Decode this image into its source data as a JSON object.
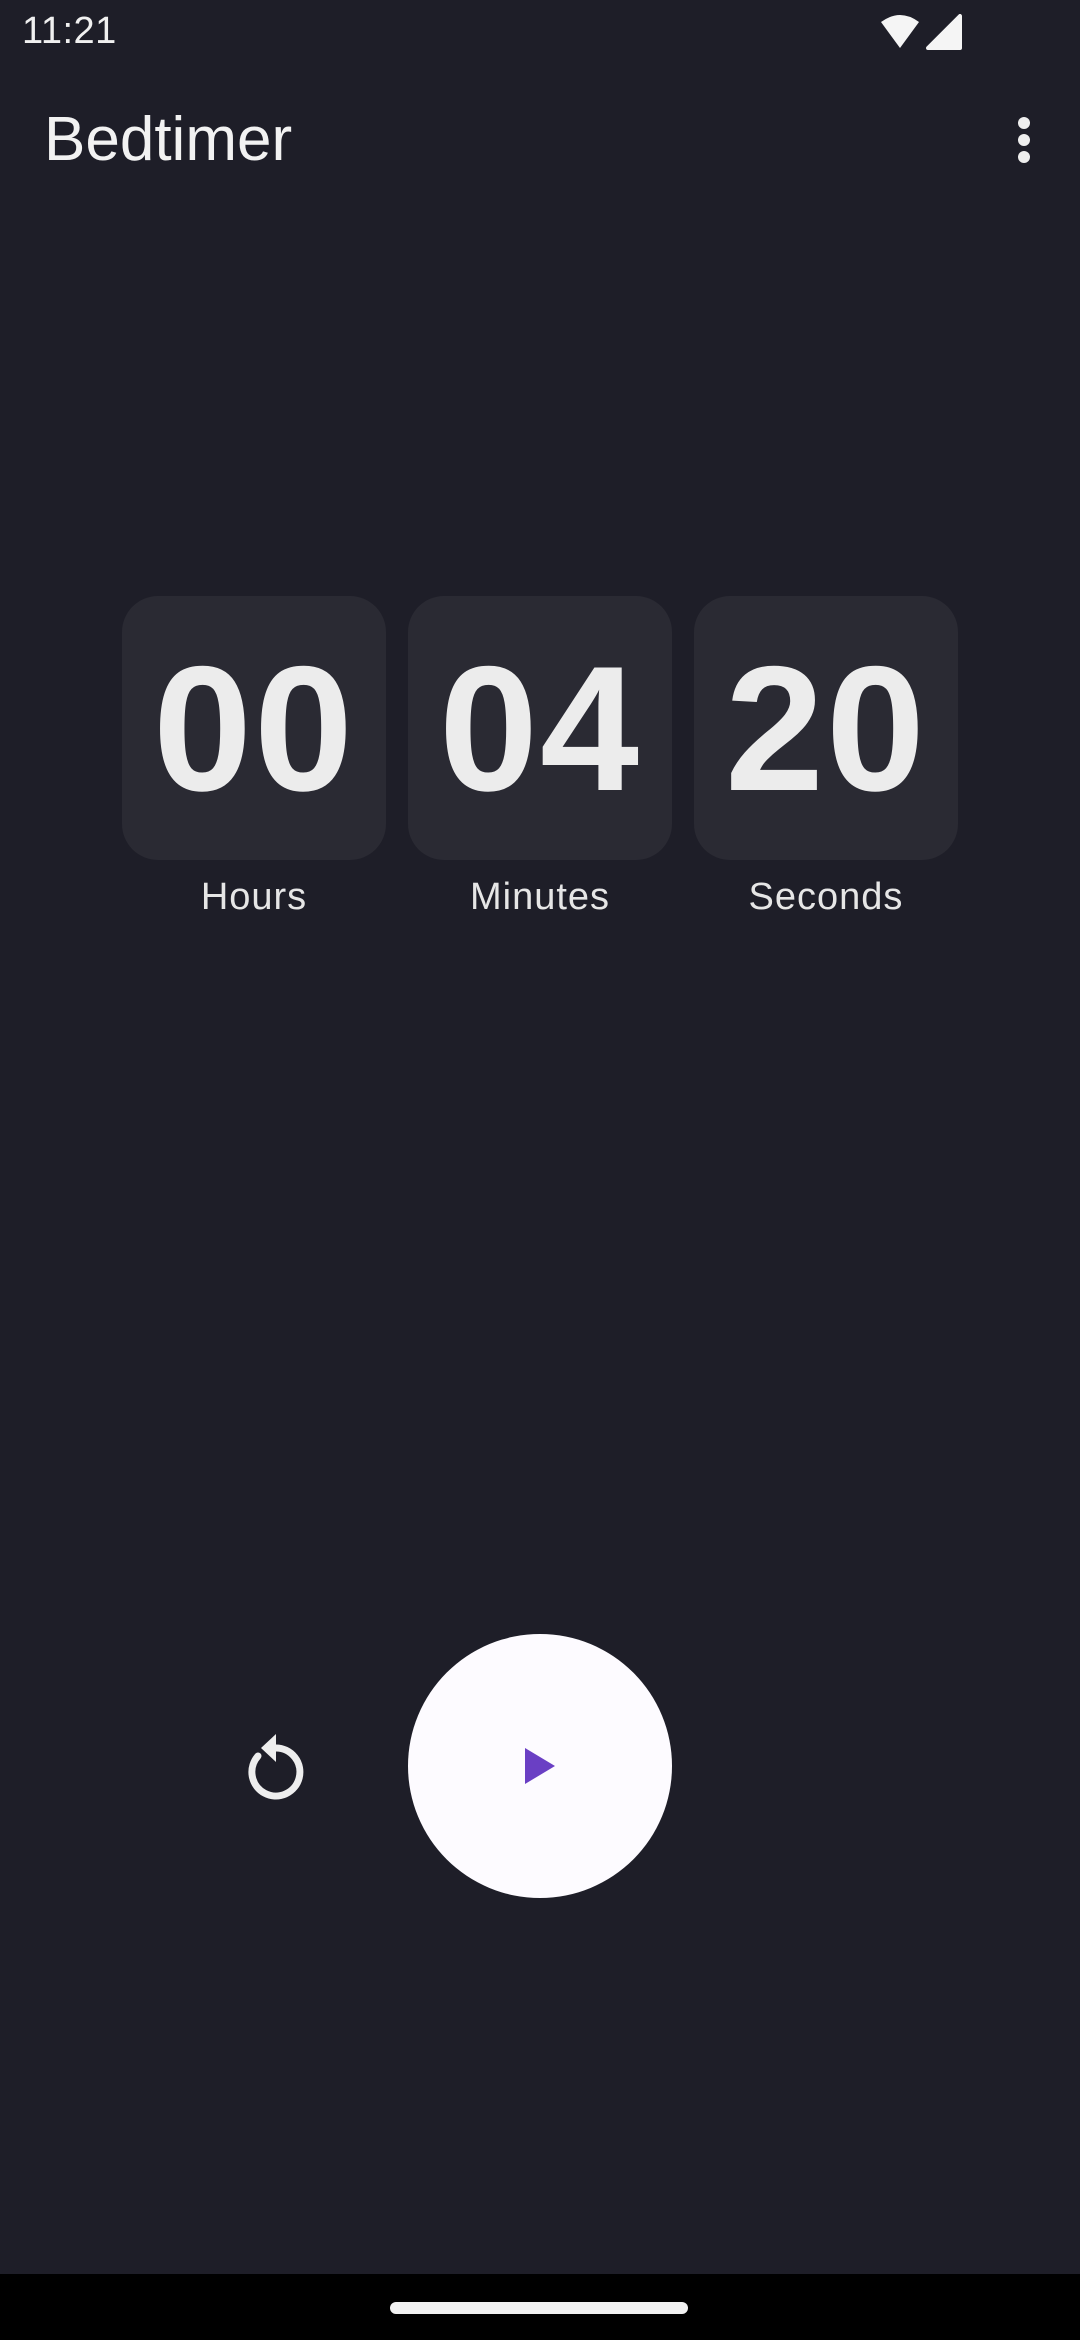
{
  "status_bar": {
    "time": "11:21",
    "icons": [
      "wifi-icon",
      "signal-icon"
    ]
  },
  "app_bar": {
    "title": "Bedtimer",
    "overflow_icon": "more-vert-icon"
  },
  "timer": {
    "hours": {
      "value": "00",
      "label": "Hours"
    },
    "minutes": {
      "value": "04",
      "label": "Minutes"
    },
    "seconds": {
      "value": "20",
      "label": "Seconds"
    }
  },
  "controls": {
    "reset_icon": "reset-icon",
    "play_icon": "play-icon"
  },
  "colors": {
    "background": "#1e1e28",
    "digit_box": "#2a2a33",
    "play_button": "#fdfbff",
    "accent": "#6a3fc4",
    "text": "#eeeeee"
  }
}
